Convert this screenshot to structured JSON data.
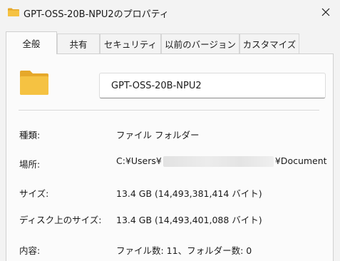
{
  "window": {
    "title": "GPT-OSS-20B-NPU2のプロパティ"
  },
  "tabs": [
    {
      "label": "全般",
      "active": true
    },
    {
      "label": "共有",
      "active": false
    },
    {
      "label": "セキュリティ",
      "active": false
    },
    {
      "label": "以前のバージョン",
      "active": false
    },
    {
      "label": "カスタマイズ",
      "active": false
    }
  ],
  "folder": {
    "name": "GPT-OSS-20B-NPU2"
  },
  "properties": {
    "type": {
      "label": "種類:",
      "value": "ファイル フォルダー"
    },
    "location": {
      "label": "場所:",
      "prefix": "C:¥Users¥",
      "suffix": "¥Document"
    },
    "size": {
      "label": "サイズ:",
      "value": "13.4 GB (14,493,381,414 バイト)"
    },
    "size_on_disk": {
      "label": "ディスク上のサイズ:",
      "value": "13.4 GB (14,493,401,088 バイト)"
    },
    "contents": {
      "label": "内容:",
      "value": "ファイル数: 11、フォルダー数: 0"
    }
  },
  "colors": {
    "folder": "#f5c242",
    "folder_dark": "#e6a82a",
    "panel": "#fbfbfb",
    "chrome": "#f3f3f3"
  }
}
